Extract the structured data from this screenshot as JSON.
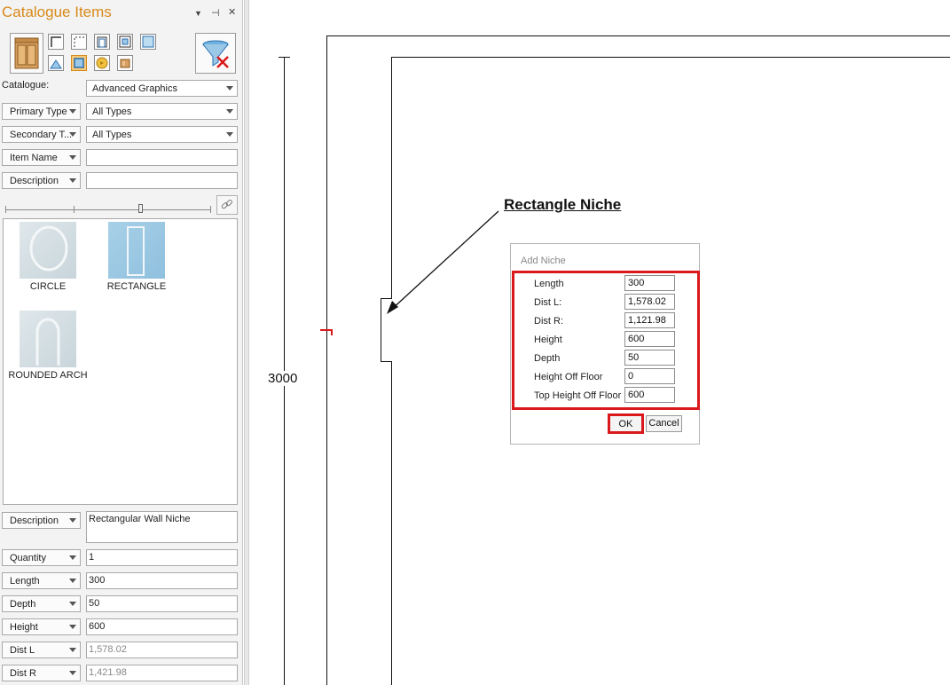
{
  "panel": {
    "title": "Catalogue Items",
    "controls": {
      "dropdown_glyph": "▼",
      "pin_glyph": "⊣",
      "close_glyph": "✕"
    },
    "catalogue_label": "Catalogue:",
    "catalogue_value": "Advanced Graphics",
    "primary_type": {
      "label": "Primary Type",
      "value": "All Types"
    },
    "secondary_type": {
      "label": "Secondary T...",
      "value": "All Types"
    },
    "item_name": {
      "label": "Item Name",
      "value": ""
    },
    "description_filter": {
      "label": "Description",
      "value": ""
    },
    "gallery": [
      {
        "caption": "CIRCLE",
        "icon": "circle-niche-thumbnail",
        "selected": false
      },
      {
        "caption": "RECTANGLE",
        "icon": "rectangle-niche-thumbnail",
        "selected": true
      },
      {
        "caption": "ROUNDED ARCH",
        "icon": "arch-niche-thumbnail",
        "selected": false
      }
    ],
    "properties": [
      {
        "label": "Description",
        "value": "Rectangular Wall Niche"
      },
      {
        "label": "Quantity",
        "value": "1"
      },
      {
        "label": "Length",
        "value": "300"
      },
      {
        "label": "Depth",
        "value": "50"
      },
      {
        "label": "Height",
        "value": "600"
      },
      {
        "label": "Dist L",
        "value": "1,578.02"
      },
      {
        "label": "Dist R",
        "value": "1,421.98"
      }
    ]
  },
  "drawing": {
    "dimension": "3000",
    "callout": "Rectangle Niche"
  },
  "dialog": {
    "title": "Add Niche",
    "fields": [
      {
        "label": "Length",
        "value": "300"
      },
      {
        "label": "Dist L:",
        "value": "1,578.02"
      },
      {
        "label": "Dist R:",
        "value": "1,121.98"
      },
      {
        "label": "Height",
        "value": "600"
      },
      {
        "label": "Depth",
        "value": "50"
      },
      {
        "label": "Height Off Floor",
        "value": "0"
      },
      {
        "label": "Top Height Off Floor",
        "value": "600"
      }
    ],
    "ok_label": "OK",
    "cancel_label": "Cancel"
  },
  "colors": {
    "accent": "#d8891a",
    "highlight": "#d9191c",
    "selection": "#f7c97a"
  }
}
